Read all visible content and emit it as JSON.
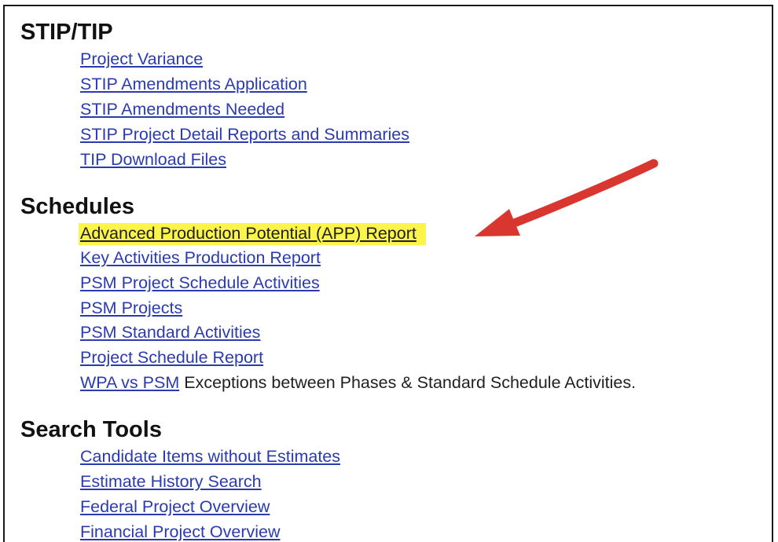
{
  "sections": [
    {
      "title": "STIP/TIP",
      "links": [
        "Project Variance",
        "STIP Amendments Application",
        "STIP Amendments Needed",
        "STIP Project Detail Reports and Summaries",
        "TIP Download Files"
      ]
    },
    {
      "title": "Schedules",
      "links": [
        "Advanced Production Potential (APP) Report",
        "Key Activities Production Report",
        "PSM Project Schedule Activities",
        "PSM Projects",
        "PSM Standard Activities",
        "Project Schedule Report",
        "WPA vs PSM"
      ],
      "wpa_description": "Exceptions between Phases & Standard Schedule Activities."
    },
    {
      "title": "Search Tools",
      "links": [
        "Candidate Items without Estimates",
        "Estimate History Search",
        "Federal Project Overview",
        "Financial Project Overview"
      ]
    }
  ],
  "colors": {
    "link": "#2a3bb0",
    "highlight": "#fbf44a",
    "arrow": "#d9362f"
  },
  "icons": {
    "annotation": "red-arrow-icon"
  }
}
